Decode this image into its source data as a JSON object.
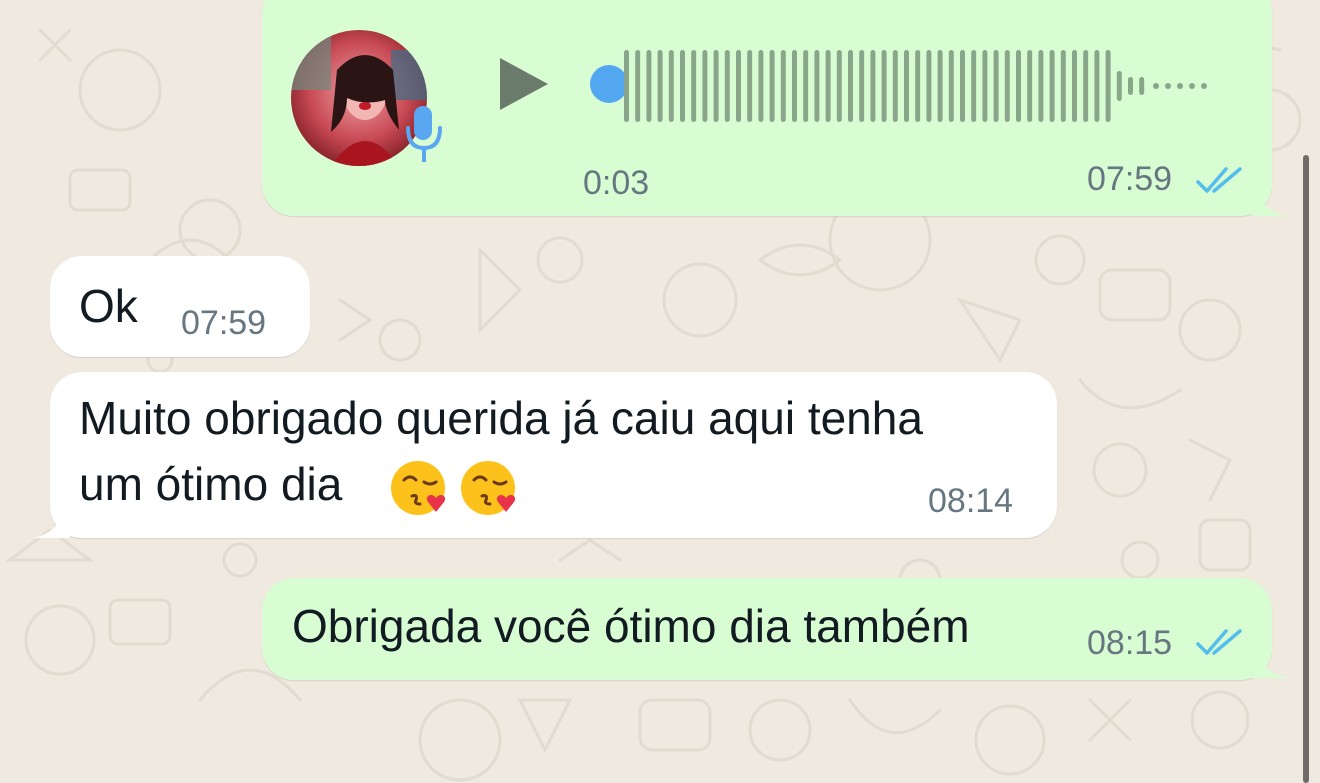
{
  "theme": {
    "outgoing_bg": "#d9fdd3",
    "incoming_bg": "#ffffff",
    "time_color": "#667781",
    "tick_color": "#53bdeb",
    "voice_dot": "#53a7f0",
    "wave_color": "#8aa68a",
    "play_color": "#6b7b6b"
  },
  "messages": [
    {
      "type": "voice",
      "direction": "outgoing",
      "duration": "0:03",
      "time": "07:59",
      "status": "read",
      "icons": [
        "play-icon",
        "microphone-icon",
        "double-check-icon"
      ]
    },
    {
      "type": "text",
      "direction": "incoming",
      "text": "Ok",
      "time": "07:59"
    },
    {
      "type": "text",
      "direction": "incoming",
      "line1": "Muito obrigado querida já caiu aqui tenha",
      "line2": "um ótimo dia",
      "emojis": [
        "kissing-face-with-heart-emoji",
        "kissing-face-with-heart-emoji"
      ],
      "time": "08:14"
    },
    {
      "type": "text",
      "direction": "outgoing",
      "text": "Obrigada você ótimo dia também",
      "time": "08:15",
      "status": "read",
      "icons": [
        "double-check-icon"
      ]
    }
  ]
}
